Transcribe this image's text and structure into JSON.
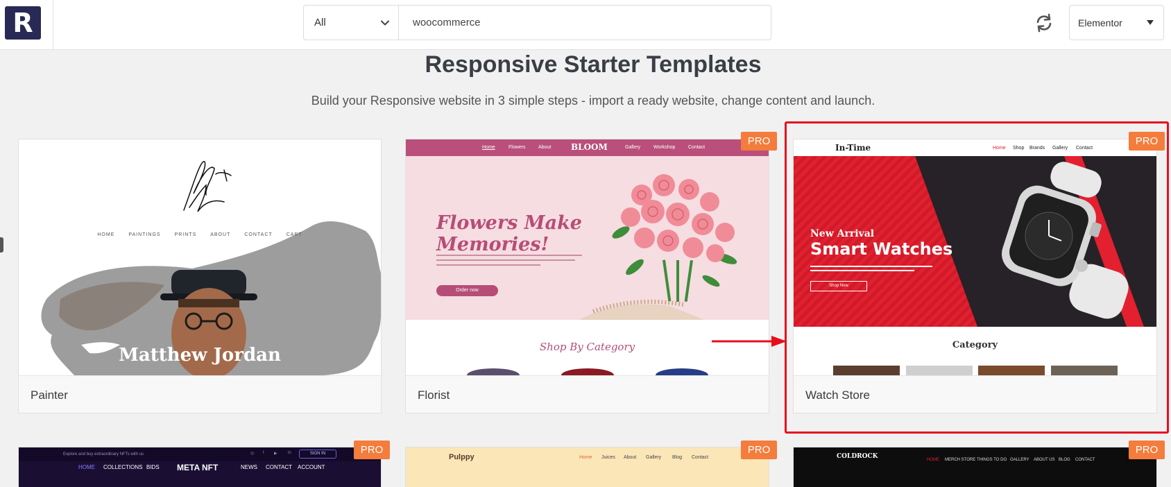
{
  "header": {
    "logo_letter": "R",
    "category_select": "All",
    "search_value": "woocommerce",
    "builder_select": "Elementor"
  },
  "page": {
    "title": "Responsive Starter Templates",
    "subtitle": "Build your Responsive website in 3 simple steps - import a ready website, change content and launch."
  },
  "badge_label": "PRO",
  "templates": [
    {
      "name": "Painter",
      "pro": false,
      "preview": {
        "signature": "Matthew Jordan",
        "nav": [
          "HOME",
          "PAINTINGS",
          "PRINTS",
          "ABOUT",
          "CONTACT",
          "CART"
        ],
        "hero_name": "Matthew Jordan"
      }
    },
    {
      "name": "Florist",
      "pro": true,
      "preview": {
        "nav_left": [
          "Home",
          "Flowers",
          "About"
        ],
        "brand": "BLOOM",
        "nav_right": [
          "Gallery",
          "Workshop",
          "Contact"
        ],
        "headline_1": "Flowers Make",
        "headline_2": "Memories!",
        "button": "Order now",
        "section": "Shop By Category"
      }
    },
    {
      "name": "Watch Store",
      "pro": true,
      "preview": {
        "brand": "In-Time",
        "nav": [
          "Home",
          "Shop",
          "Brands",
          "Gallery",
          "Contact"
        ],
        "kicker": "New Arrival",
        "headline": "Smart Watches",
        "button": "Shop Now",
        "section": "Category"
      }
    }
  ],
  "row2": [
    {
      "pro": true,
      "top_text": "Explore and buy extraordinary NFTs with us",
      "signin": "SIGN IN",
      "nav_left": [
        "HOME",
        "COLLECTIONS",
        "BIDS"
      ],
      "brand": "META NFT",
      "nav_right": [
        "NEWS",
        "CONTACT",
        "ACCOUNT"
      ]
    },
    {
      "pro": true,
      "brand": "Pulppy",
      "nav": [
        "Home",
        "Juices",
        "About",
        "Gallery",
        "Blog",
        "Contact"
      ]
    },
    {
      "pro": true,
      "brand": "COLDROCK",
      "nav": [
        "HOME",
        "MERCH STORE",
        "THINGS TO DO",
        "GALLERY",
        "ABOUT US",
        "BLOG",
        "CONTACT"
      ]
    }
  ],
  "colors": {
    "pro_badge": "#f47c3c",
    "highlight": "#e80d1c",
    "logo_bg": "#282a55"
  }
}
